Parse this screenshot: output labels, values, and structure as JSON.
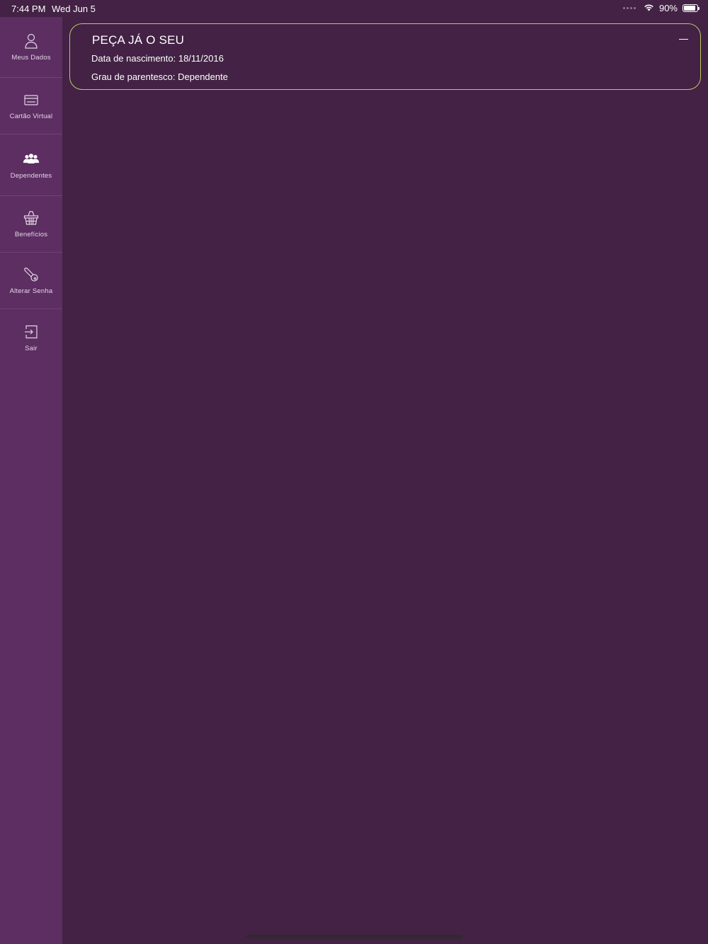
{
  "status_bar": {
    "time": "7:44 PM",
    "date": "Wed Jun 5",
    "battery": "90%",
    "battery_level": 0.9
  },
  "sidebar": {
    "items": [
      {
        "label": "Meus Dados",
        "icon": "user-icon"
      },
      {
        "label": "Cartão Virtual",
        "icon": "card-icon"
      },
      {
        "label": "Dependentes",
        "icon": "group-icon"
      },
      {
        "label": "Benefícios",
        "icon": "basket-icon"
      },
      {
        "label": "Alterar Senha",
        "icon": "key-icon"
      },
      {
        "label": "Sair",
        "icon": "logout-icon"
      }
    ]
  },
  "dependent_card": {
    "name": "PEÇA JÁ O SEU",
    "birth_date": "Data de nascimento: 18/11/2016",
    "relationship": "Grau de parentesco: Dependente",
    "border_color": "#b7cc63"
  },
  "colors": {
    "background": "#432245",
    "sidebar": "#5c2e62"
  }
}
